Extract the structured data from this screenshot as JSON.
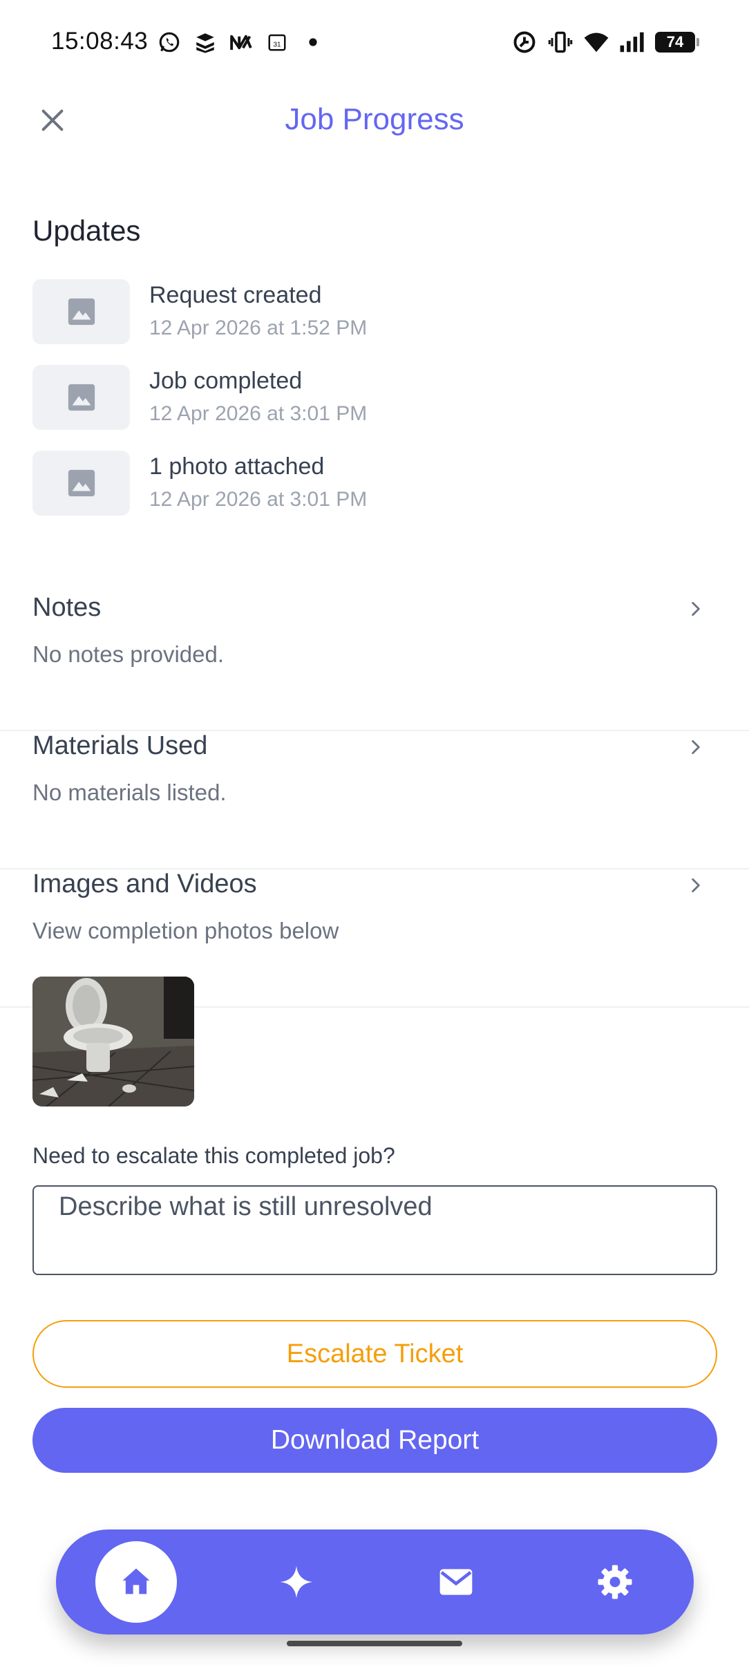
{
  "status_bar": {
    "time": "15:08:43",
    "left_icons": [
      "whatsapp-icon",
      "stack-icon",
      "nx-logo-icon",
      "calendar-icon",
      "dot-icon"
    ],
    "right_icons": [
      "alarm-icon",
      "vibrate-icon",
      "wifi-icon",
      "signal-icon"
    ],
    "battery": "74"
  },
  "header": {
    "title": "Job Progress",
    "close_icon": "close-icon"
  },
  "updates": {
    "heading": "Updates",
    "items": [
      {
        "title": "Request created",
        "date": "12 Apr 2026 at 1:52 PM"
      },
      {
        "title": "Job completed",
        "date": "12 Apr 2026 at 3:01 PM"
      },
      {
        "title": "1 photo attached",
        "date": "12 Apr 2026 at 3:01 PM"
      }
    ]
  },
  "sections": {
    "notes": {
      "title": "Notes",
      "subtitle": "No notes provided."
    },
    "materials": {
      "title": "Materials Used",
      "subtitle": "No materials listed."
    },
    "media": {
      "title": "Images and Videos",
      "subtitle": "View completion photos below"
    }
  },
  "escalate": {
    "label": "Need to escalate this completed job?",
    "placeholder": "Describe what is still unresolved",
    "value": "",
    "escalate_button": "Escalate Ticket",
    "download_button": "Download Report"
  },
  "bottom_nav": {
    "items": [
      "home-icon",
      "sparkle-icon",
      "mail-icon",
      "settings-icon"
    ],
    "active": "home-icon"
  },
  "colors": {
    "accent": "#6366f1",
    "warning": "#f59e0b",
    "text": "#374151",
    "muted": "#9ca3af"
  }
}
